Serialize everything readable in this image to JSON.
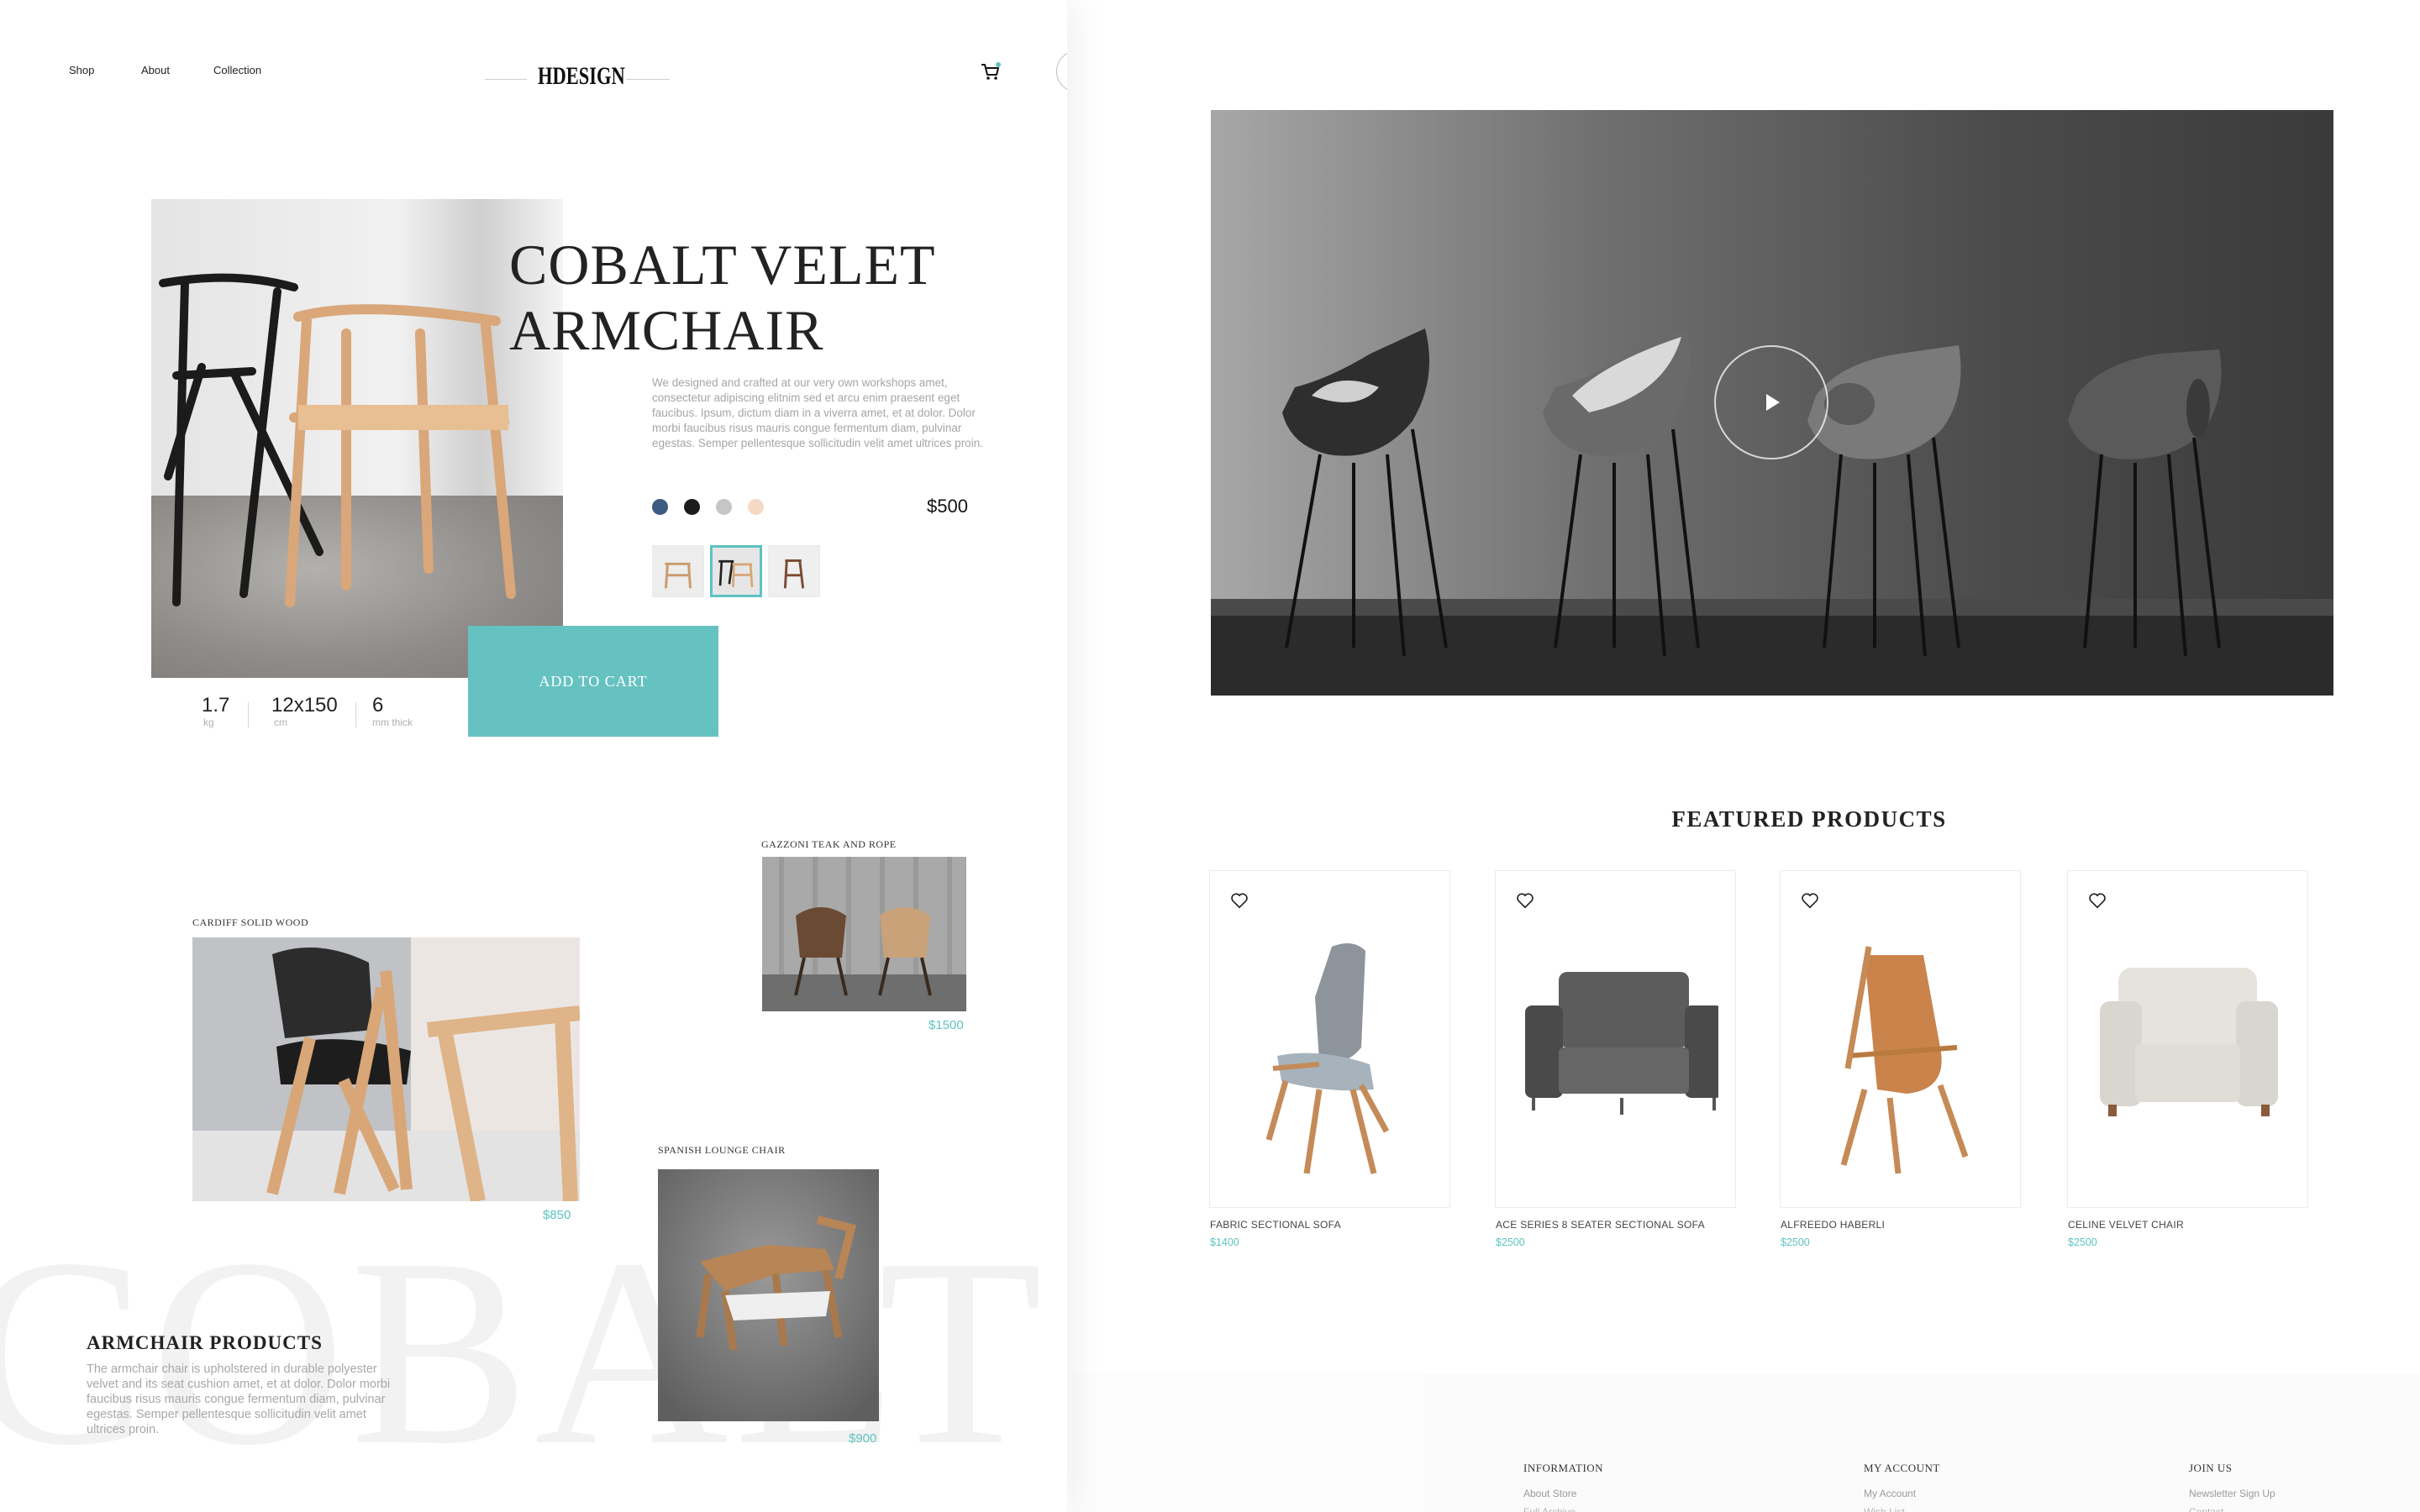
{
  "nav": {
    "shop": "Shop",
    "about": "About",
    "collection": "Collection",
    "logo": "HDESIGN"
  },
  "hero": {
    "title_line1": "COBALT VELET",
    "title_line2": "ARMCHAIR",
    "description": "We designed and crafted at our very own workshops amet, consectetur adipiscing elitnim sed et arcu enim praesent eget faucibus. Ipsum, dictum diam in a viverra amet, et at dolor. Dolor morbi faucibus risus mauris congue fermentum diam, pulvinar egestas. Semper pellentesque sollicitudin velit amet ultrices proin.",
    "price": "$500",
    "swatches": [
      "#3d5a80",
      "#1c1c1c",
      "#c6c6c6",
      "#f5d9c4"
    ],
    "add_to_cart": "ADD TO CART",
    "specs": [
      {
        "value": "1.7",
        "unit": "kg"
      },
      {
        "value": "12x150",
        "unit": "cm"
      },
      {
        "value": "6",
        "unit": "mm thick"
      }
    ]
  },
  "collection": {
    "items": [
      {
        "name": "GAZZONI TEAK AND ROPE",
        "price": "$1500"
      },
      {
        "name": "CARDIFF SOLID WOOD",
        "price": "$850"
      },
      {
        "name": "SPANISH LOUNGE CHAIR",
        "price": "$900"
      }
    ],
    "background_word": "COBALT",
    "armchair_heading": "ARMCHAIR PRODUCTS",
    "armchair_description": "The armchair chair is upholstered in durable polyester velvet and its seat cushion amet, et at dolor. Dolor morbi faucibus risus mauris congue fermentum diam, pulvinar egestas. Semper pellentesque sollicitudin velit amet ultrices proin."
  },
  "featured": {
    "heading": "FEATURED PRODUCTS",
    "products": [
      {
        "name": "FABRIC SECTIONAL SOFA",
        "price": "$1400"
      },
      {
        "name": "ACE SERIES 8 SEATER SECTIONAL SOFA",
        "price": "$2500"
      },
      {
        "name": "ALFREEDO HABERLI",
        "price": "$2500"
      },
      {
        "name": "CELINE VELVET CHAIR",
        "price": "$2500"
      }
    ]
  },
  "footer": {
    "information": {
      "heading": "INFORMATION",
      "link1": "About Store",
      "link2": "Full Archive"
    },
    "account": {
      "heading": "MY ACCOUNT",
      "link1": "My Account",
      "link2": "Wish List"
    },
    "join": {
      "heading": "JOIN US",
      "link1": "Newsletter Sign Up",
      "link2": "Contact"
    }
  },
  "colors": {
    "accent": "#66c2c1",
    "text": "#222222",
    "muted": "#a6a6a6"
  },
  "icons": {
    "cart": "cart-icon",
    "heart": "heart-icon",
    "play": "play-icon"
  }
}
